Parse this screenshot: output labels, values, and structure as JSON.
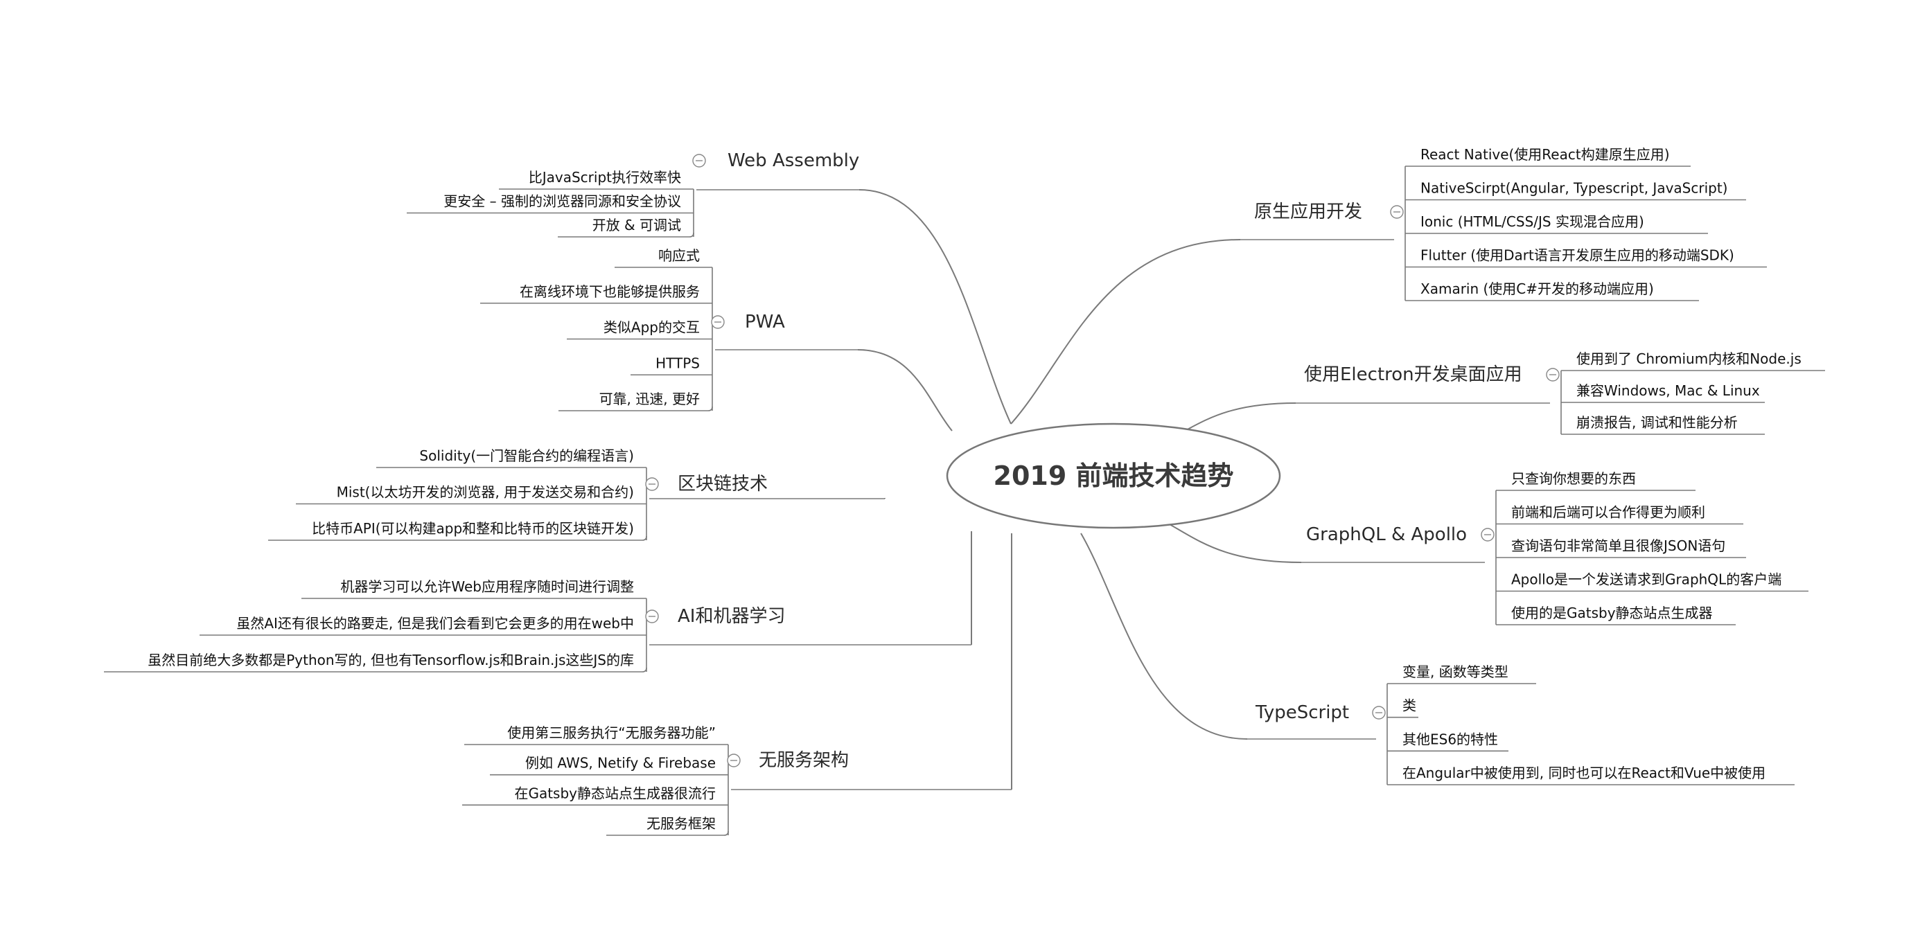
{
  "root": {
    "label": "2019 前端技术趋势"
  },
  "branches": [
    {
      "label": "Web Assembly",
      "leaves": [
        "比JavaScript执行效率快",
        "更安全 – 强制的浏览器同源和安全协议",
        "开放 & 可调试"
      ]
    },
    {
      "label": "PWA",
      "leaves": [
        "响应式",
        "在离线环境下也能够提供服务",
        "类似App的交互",
        "HTTPS",
        "可靠, 迅速, 更好"
      ]
    },
    {
      "label": "区块链技术",
      "leaves": [
        "Solidity(一门智能合约的编程语言)",
        "Mist(以太坊开发的浏览器, 用于发送交易和合约)",
        "比特币API(可以构建app和整和比特币的区块链开发)"
      ]
    },
    {
      "label": "AI和机器学习",
      "leaves": [
        "机器学习可以允许Web应用程序随时间进行调整",
        "虽然AI还有很长的路要走, 但是我们会看到它会更多的用在web中",
        "虽然目前绝大多数都是Python写的, 但也有Tensorflow.js和Brain.js这些JS的库"
      ]
    },
    {
      "label": "无服务架构",
      "leaves": [
        "使用第三服务执行“无服务器功能”",
        "例如 AWS, Netify & Firebase",
        "在Gatsby静态站点生成器很流行",
        "无服务框架"
      ]
    },
    {
      "label": "原生应用开发",
      "leaves": [
        "React Native(使用React构建原生应用)",
        "NativeScirpt(Angular, Typescript, JavaScript)",
        "Ionic (HTML/CSS/JS 实现混合应用)",
        "Flutter (使用Dart语言开发原生应用的移动端SDK)",
        "Xamarin (使用C#开发的移动端应用)"
      ]
    },
    {
      "label": "使用Electron开发桌面应用",
      "leaves": [
        "使用到了 Chromium内核和Node.js",
        "兼容Windows, Mac & Linux",
        "崩溃报告, 调试和性能分析"
      ]
    },
    {
      "label": "GraphQL & Apollo",
      "leaves": [
        "只查询你想要的东西",
        "前端和后端可以合作得更为顺利",
        "查询语句非常简单且很像JSON语句",
        "Apollo是一个发送请求到GraphQL的客户端",
        "使用的是Gatsby静态站点生成器"
      ]
    },
    {
      "label": "TypeScript",
      "leaves": [
        "变量, 函数等类型",
        "类",
        "其他ES6的特性",
        "在Angular中被使用到, 同时也可以在React和Vue中被使用"
      ]
    }
  ]
}
